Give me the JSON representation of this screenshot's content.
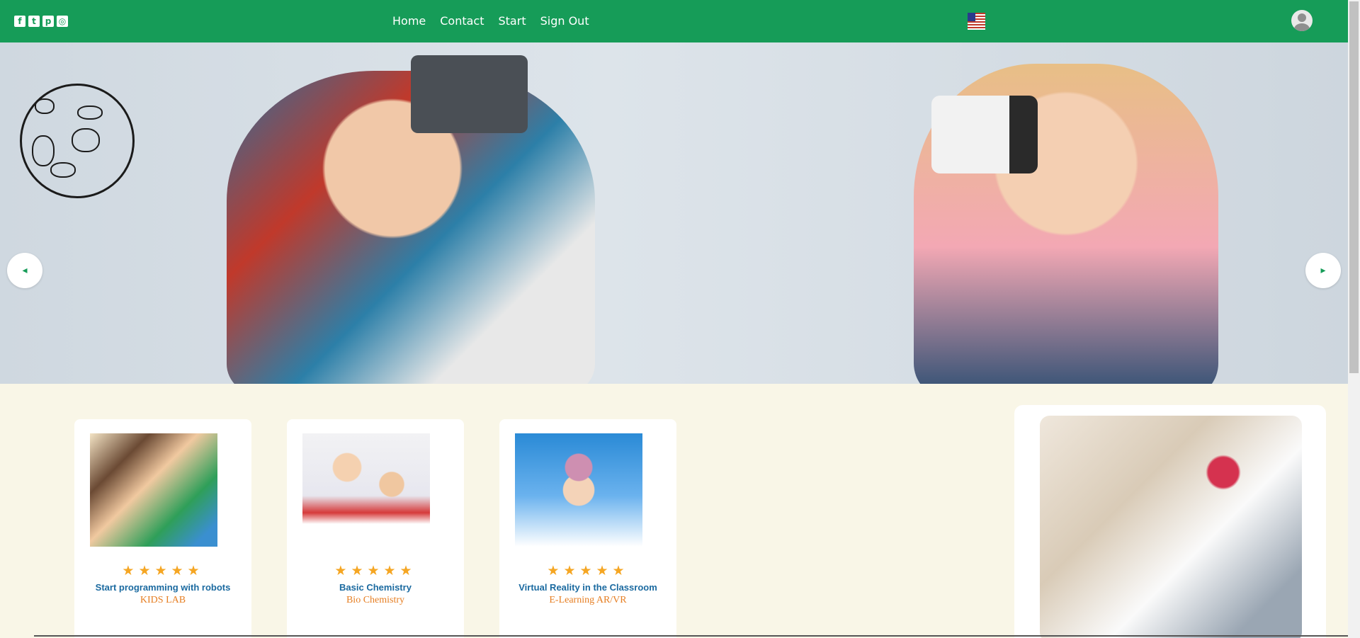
{
  "nav": {
    "social": [
      "facebook-icon",
      "twitter-icon",
      "pinterest-icon",
      "instagram-icon"
    ],
    "links": [
      "Home",
      "Contact",
      "Start",
      "Sign Out"
    ],
    "language_flag": "us-flag-icon"
  },
  "hero": {
    "prev_label": "◂",
    "next_label": "▸"
  },
  "cards": [
    {
      "title": "Start programming with robots",
      "subtitle": "KIDS LAB",
      "rating": 5
    },
    {
      "title": "Basic Chemistry",
      "subtitle": "Bio Chemistry",
      "rating": 5
    },
    {
      "title": "Virtual Reality in the Classroom",
      "subtitle": "E-Learning AR/VR",
      "rating": 5
    }
  ],
  "stars_text": "★★★★★",
  "colors": {
    "accent": "#169c58",
    "page_bg": "#f9f6e7",
    "title_blue": "#1b6aa0",
    "subtitle_orange": "#e67e22",
    "star": "#f5a623"
  }
}
